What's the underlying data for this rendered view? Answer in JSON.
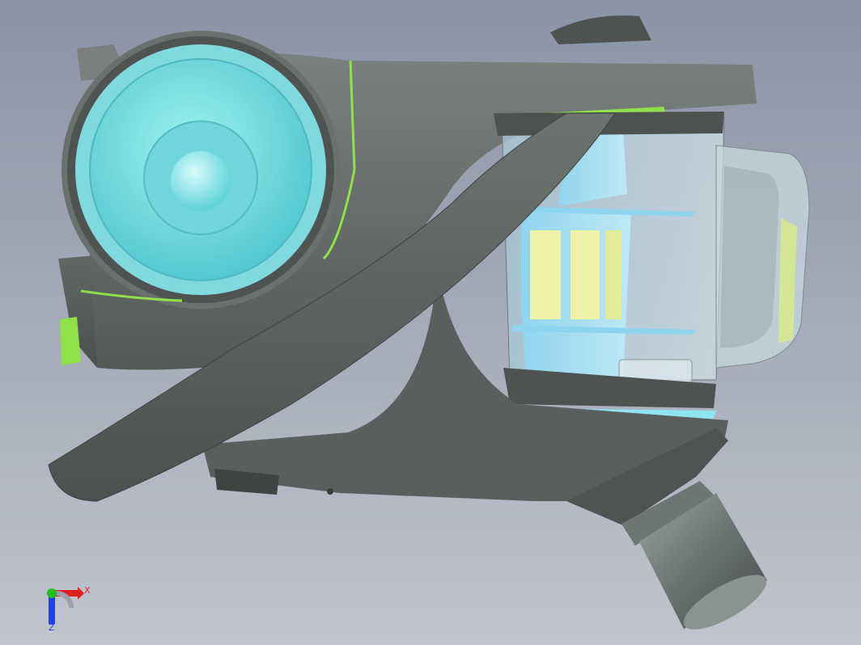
{
  "viewport": {
    "background_top": "#8b93a6",
    "background_bottom": "#c0c4cd"
  },
  "model": {
    "body_color": "#5f6563",
    "body_dark": "#4a4f4e",
    "accent_green": "#8fe04a",
    "cyan_cover": "#6fe0e6",
    "bin_tint": "#bcd8e4",
    "filter_yellow": "#eef2a8"
  },
  "triad": {
    "x_label": "X",
    "z_label": "Z",
    "x_color": "#e02020",
    "y_color": "#20c020",
    "z_color": "#2040e0"
  }
}
